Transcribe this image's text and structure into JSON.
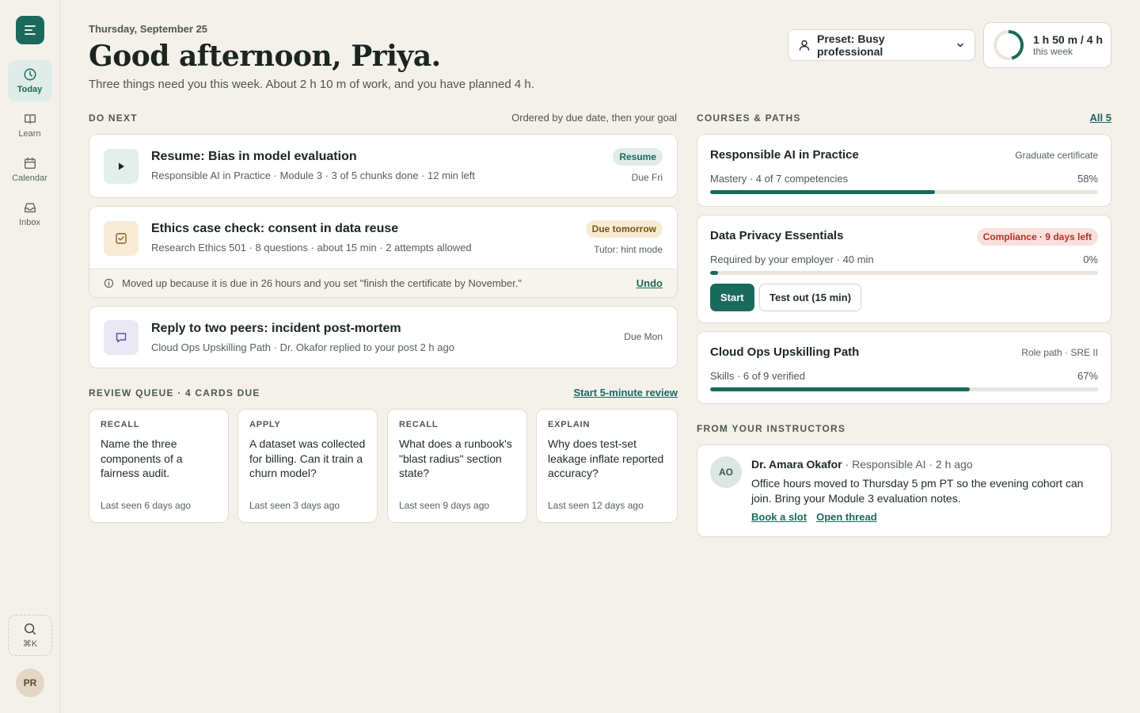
{
  "sidebar": {
    "items": [
      {
        "label": "Today",
        "icon": "clock-icon",
        "active": true
      },
      {
        "label": "Learn",
        "icon": "book-icon",
        "active": false
      },
      {
        "label": "Calendar",
        "icon": "calendar-icon",
        "active": false
      },
      {
        "label": "Inbox",
        "icon": "inbox-icon",
        "active": false
      }
    ],
    "search_shortcut": "⌘K",
    "avatar_initials": "PR"
  },
  "header": {
    "date": "Thursday, September 25",
    "greeting": "Good afternoon, Priya.",
    "subtitle": "Three things need you this week. About 2 h 10 m of work, and you have planned 4 h.",
    "preset_label": "Preset: Busy professional",
    "time_main": "1 h 50 m / 4 h",
    "time_sub": "this week",
    "time_progress": 0.46
  },
  "do_next": {
    "title": "DO NEXT",
    "meta": "Ordered by due date, then your goal",
    "tasks": [
      {
        "title": "Resume: Bias in model evaluation",
        "meta": "Responsible AI in Practice · Module 3 · 3 of 5 chunks done · 12 min left",
        "pill": "Resume",
        "due": "Due Fri"
      },
      {
        "title": "Ethics case check: consent in data reuse",
        "meta": "Research Ethics 501 · 8 questions · about 15 min · 2 attempts allowed",
        "pill": "Due tomorrow",
        "due": "Tutor: hint mode",
        "note": "Moved up because it is due in 26 hours and you set \"finish the certificate by November.\"",
        "note_action": "Undo"
      },
      {
        "title": "Reply to two peers: incident post-mortem",
        "meta": "Cloud Ops Upskilling Path · Dr. Okafor replied to your post 2 h ago",
        "due": "Due Mon"
      }
    ]
  },
  "review": {
    "title": "REVIEW QUEUE · 4 CARDS DUE",
    "action": "Start 5-minute review",
    "cards": [
      {
        "kind": "RECALL",
        "question": "Name the three components of a fairness audit.",
        "seen": "Last seen 6 days ago"
      },
      {
        "kind": "APPLY",
        "question": "A dataset was collected for billing. Can it train a churn model?",
        "seen": "Last seen 3 days ago"
      },
      {
        "kind": "RECALL",
        "question": "What does a runbook's \"blast radius\" section state?",
        "seen": "Last seen 9 days ago"
      },
      {
        "kind": "EXPLAIN",
        "question": "Why does test-set leakage inflate reported accuracy?",
        "seen": "Last seen 12 days ago"
      }
    ]
  },
  "courses": {
    "title": "COURSES & PATHS",
    "action": "All 5",
    "items": [
      {
        "title": "Responsible AI in Practice",
        "tag": "Graduate certificate",
        "line": "Mastery · 4 of 7 competencies",
        "pct": "58%",
        "progress": 0.58
      },
      {
        "title": "Data Privacy Essentials",
        "tag": "Compliance · 9 days left",
        "line": "Required by your employer · 40 min",
        "pct": "0%",
        "progress": 0.02,
        "primary": "Start",
        "secondary": "Test out (15 min)"
      },
      {
        "title": "Cloud Ops Upskilling Path",
        "tag": "Role path · SRE II",
        "line": "Skills · 6 of 9 verified",
        "pct": "67%",
        "progress": 0.67
      }
    ]
  },
  "instructors": {
    "title": "FROM YOUR INSTRUCTORS",
    "message": {
      "initials": "AO",
      "name": "Dr. Amara Okafor",
      "context": " · Responsible AI · 2 h ago",
      "body": "Office hours moved to Thursday 5 pm PT so the evening cohort can join. Bring your Module 3 evaluation notes.",
      "action1": "Book a slot",
      "action2": "Open thread"
    }
  },
  "colors": {
    "accent": "#1a6a5c",
    "background": "#f4f1eb",
    "warning": "#f7ecd3",
    "danger": "#f9e0dc"
  }
}
